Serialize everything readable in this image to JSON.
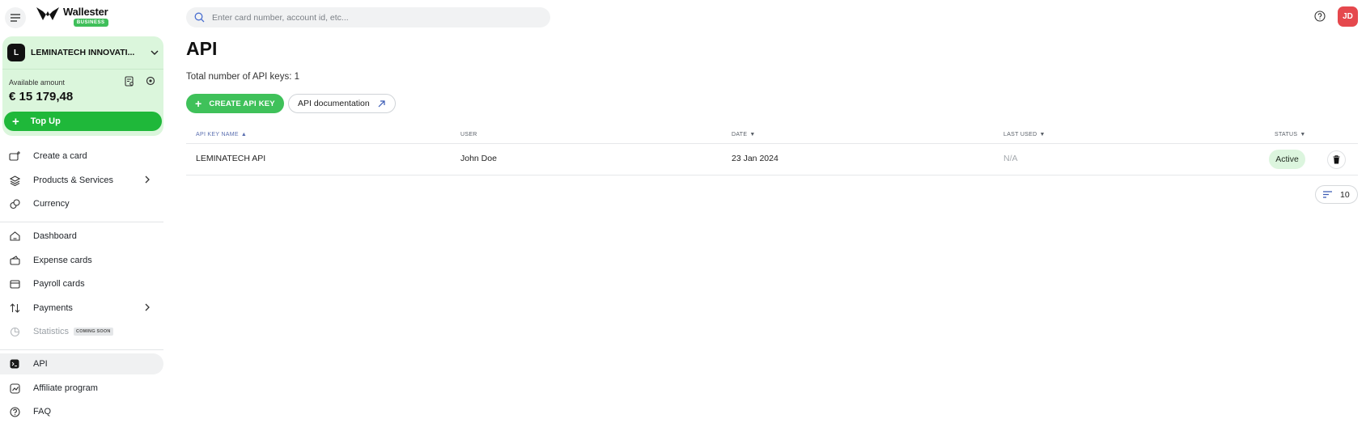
{
  "brand": {
    "name": "Wallester",
    "badge": "BUSINESS"
  },
  "account": {
    "initial": "L",
    "name": "LEMINATECH INNOVATI...",
    "available_label": "Available amount",
    "available_amount": "€ 15 179,48",
    "topup_label": "Top Up"
  },
  "nav": {
    "group1": [
      {
        "label": "Create a card",
        "icon": "card-plus-icon"
      },
      {
        "label": "Products & Services",
        "icon": "layers-icon",
        "has_children": true
      },
      {
        "label": "Currency",
        "icon": "currency-icon"
      }
    ],
    "group2": [
      {
        "label": "Dashboard",
        "icon": "home-icon"
      },
      {
        "label": "Expense cards",
        "icon": "wallet-icon"
      },
      {
        "label": "Payroll cards",
        "icon": "payroll-card-icon"
      },
      {
        "label": "Payments",
        "icon": "arrows-updown-icon",
        "has_children": true
      },
      {
        "label": "Statistics",
        "icon": "chart-icon",
        "badge": "COMING SOON",
        "disabled": true
      }
    ],
    "group3": [
      {
        "label": "API",
        "icon": "terminal-icon",
        "active": true
      },
      {
        "label": "Affiliate program",
        "icon": "affiliate-icon"
      },
      {
        "label": "FAQ",
        "icon": "help-icon"
      }
    ]
  },
  "search": {
    "placeholder": "Enter card number, account id, etc..."
  },
  "user": {
    "initials": "JD"
  },
  "page": {
    "title": "API",
    "total_text": "Total number of API keys: 1",
    "create_button": "CREATE API KEY",
    "doc_button": "API documentation"
  },
  "table": {
    "columns": [
      {
        "label": "API KEY NAME",
        "sort": "asc"
      },
      {
        "label": "USER",
        "sort": ""
      },
      {
        "label": "DATE",
        "sort": "desc"
      },
      {
        "label": "LAST USED",
        "sort": "desc"
      },
      {
        "label": "STATUS",
        "sort": "desc"
      }
    ],
    "rows": [
      {
        "name": "LEMINATECH API",
        "user": "John Doe",
        "date": "23 Jan 2024",
        "last_used": "N/A",
        "status": "Active"
      }
    ]
  },
  "pagination": {
    "page_size": "10"
  },
  "colors": {
    "accent": "#3fc15a",
    "topup": "#1fb83a",
    "card_bg": "#dbf6dc",
    "avatar": "#e5484d"
  }
}
